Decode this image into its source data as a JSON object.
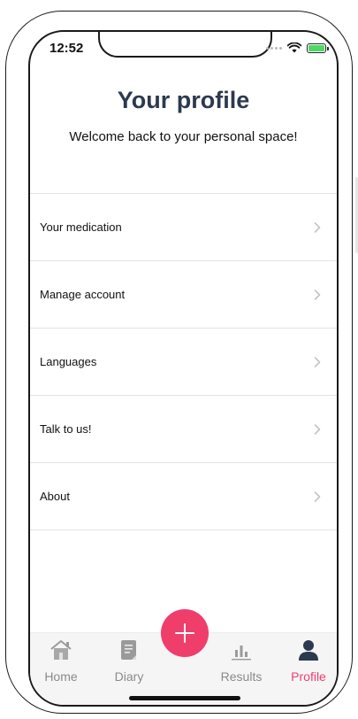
{
  "status": {
    "time": "12:52"
  },
  "header": {
    "title": "Your profile",
    "subtitle": "Welcome back to your personal space!"
  },
  "menu": {
    "items": [
      {
        "label": "Your medication"
      },
      {
        "label": "Manage account"
      },
      {
        "label": "Languages"
      },
      {
        "label": "Talk to us!"
      },
      {
        "label": "About"
      }
    ]
  },
  "tabbar": {
    "tabs": [
      {
        "label": "Home",
        "icon": "home-icon"
      },
      {
        "label": "Diary",
        "icon": "diary-icon"
      },
      {
        "label": "Results",
        "icon": "results-icon"
      },
      {
        "label": "Profile",
        "icon": "profile-icon"
      }
    ],
    "active": "Profile",
    "fab_icon": "plus-icon"
  },
  "colors": {
    "accent": "#f03e6b",
    "title": "#2c3a4f",
    "tab_inactive": "#8a8a8a",
    "battery": "#4cd964"
  }
}
